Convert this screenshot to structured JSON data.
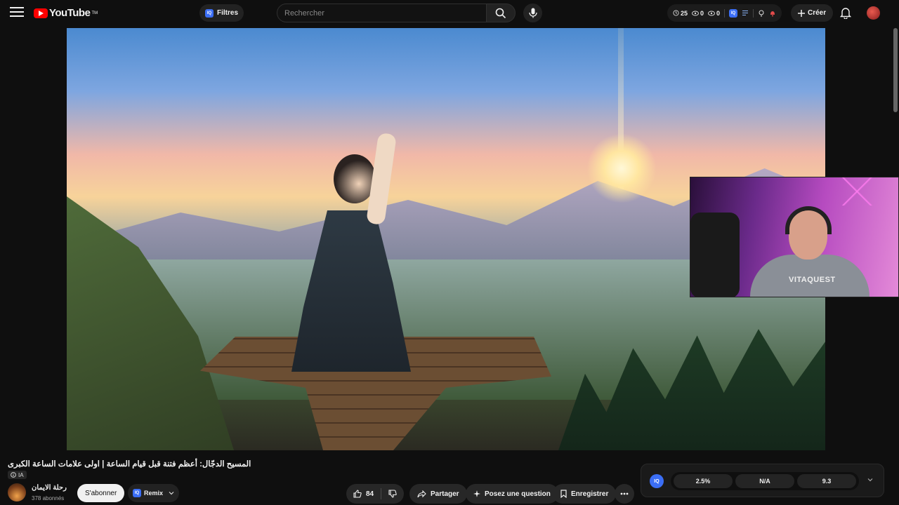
{
  "header": {
    "logo_text": "YouTube",
    "logo_tm": "TM",
    "filters_label": "Filtres",
    "filters_badge": "IQ",
    "search_placeholder": "Rechercher",
    "stats": {
      "watch": "25",
      "stat2": "0",
      "stat3": "0"
    },
    "create_label": "Créer"
  },
  "webcam": {
    "shirt_text": "VITAQUEST"
  },
  "video": {
    "title": "المسيح الدجّال: أعظم فتنة قبل قيام الساعة | اولى علامات الساعة الكبرى",
    "ai_badge": "IA"
  },
  "channel": {
    "name": "رحلة الايمان",
    "subscribers": "378 abonnés",
    "subscribe_label": "S'abonner",
    "remix_label": "Remix",
    "remix_badge": "IQ"
  },
  "actions": {
    "likes": "84",
    "share_label": "Partager",
    "ask_label": "Posez une question",
    "save_label": "Enregistrer"
  },
  "extension": {
    "badge": "IQ",
    "values": [
      "2.5%",
      "N/A",
      "9.3"
    ]
  },
  "colors": {
    "brand_red": "#ff0000",
    "iq_blue": "#3b6ef5",
    "background": "#0f0f0f"
  }
}
